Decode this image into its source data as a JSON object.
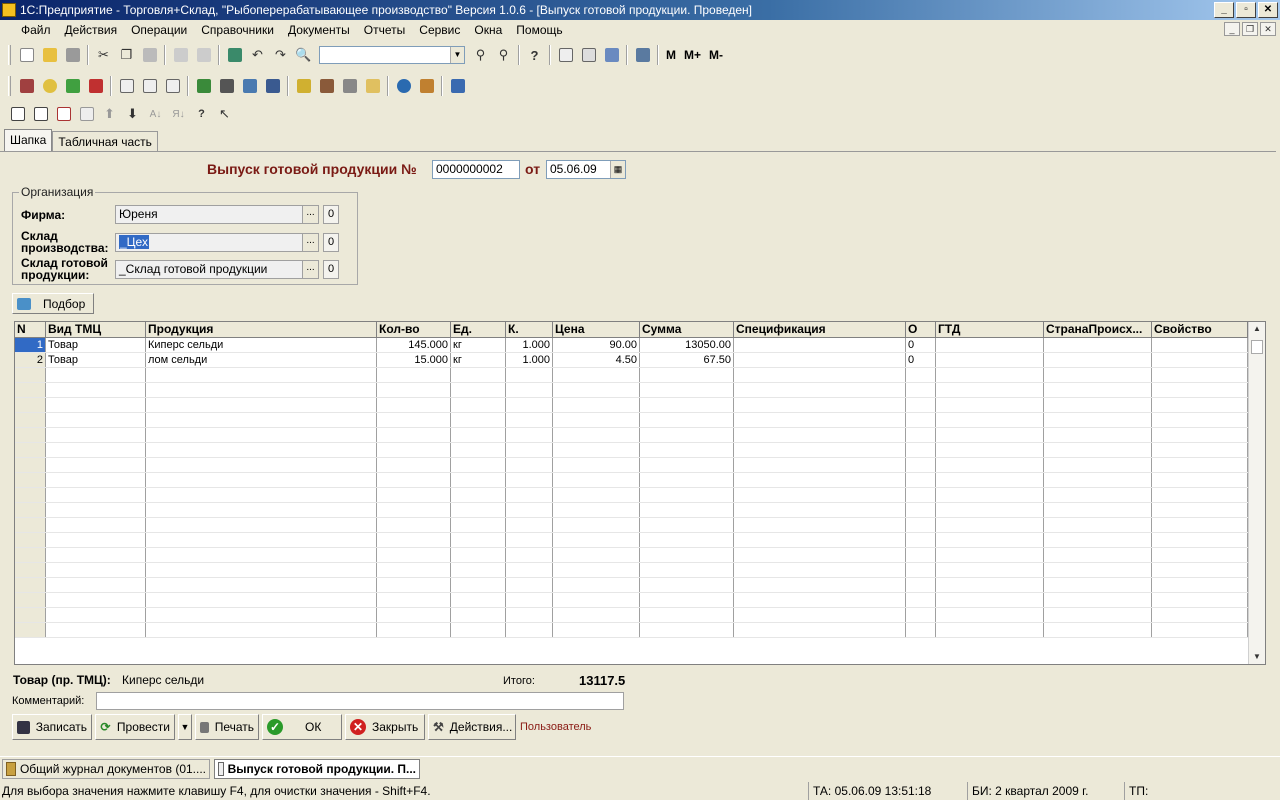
{
  "window": {
    "title": "1С:Предприятие - Торговля+Склад, \"Рыбоперерабатывающее производство\" Версия 1.0.6 - [Выпуск готовой продукции. Проведен]"
  },
  "menu": [
    "Файл",
    "Действия",
    "Операции",
    "Справочники",
    "Документы",
    "Отчеты",
    "Сервис",
    "Окна",
    "Помощь"
  ],
  "toolbar": {
    "m_label": "M",
    "mplus_label": "M+",
    "mminus_label": "M-"
  },
  "tabs": [
    "Шапка",
    "Табличная часть"
  ],
  "doc": {
    "title": "Выпуск готовой продукции №",
    "number": "0000000002",
    "date_prefix": "от",
    "date": "05.06.09"
  },
  "org": {
    "legend": "Организация",
    "firma_label": "Фирма:",
    "firma_value": "Юреня",
    "sklad_prod_label": "Склад производства:",
    "sklad_prod_value": "_Цех",
    "sklad_gotov_label": "Склад готовой продукции:",
    "sklad_gotov_value": "_Склад готовой продукции",
    "zero": "0"
  },
  "podbor_label": "Подбор",
  "table": {
    "headers": [
      "N",
      "Вид ТМЦ",
      "Продукция",
      "Кол-во",
      "Ед.",
      "К.",
      "Цена",
      "Сумма",
      "Спецификация",
      "О",
      "ГТД",
      "СтранаПроисх...",
      "Свойство"
    ],
    "rows": [
      [
        "1",
        "Товар",
        "Киперс сельди",
        "145.000",
        "кг",
        "1.000",
        "90.00",
        "13050.00",
        "",
        "0",
        "",
        "",
        ""
      ],
      [
        "2",
        "Товар",
        "лом сельди",
        "15.000",
        "кг",
        "1.000",
        "4.50",
        "67.50",
        "",
        "0",
        "",
        "",
        ""
      ]
    ]
  },
  "footer": {
    "tovar_label": "Товар (пр. ТМЦ):",
    "tovar_value": "Киперс сельди",
    "itogo_label": "Итого:",
    "itogo_value": "13117.5",
    "comment_label": "Комментарий:"
  },
  "buttons": {
    "save": "Записать",
    "post": "Провести",
    "print": "Печать",
    "ok": "ОК",
    "close": "Закрыть",
    "actions": "Действия...",
    "user": "Пользователь"
  },
  "taskbar": [
    "Общий журнал документов (01....",
    "Выпуск готовой продукции. П..."
  ],
  "status": {
    "hint": "Для выбора значения нажмите клавишу F4, для очистки значения - Shift+F4.",
    "ta": "ТА: 05.06.09  13:51:18",
    "bi": "БИ: 2 квартал 2009 г.",
    "tp": "ТП:"
  },
  "colors": {
    "title_text": "#7a1a14",
    "selection": "#316ac5",
    "window_bg": "#ece9d8"
  }
}
